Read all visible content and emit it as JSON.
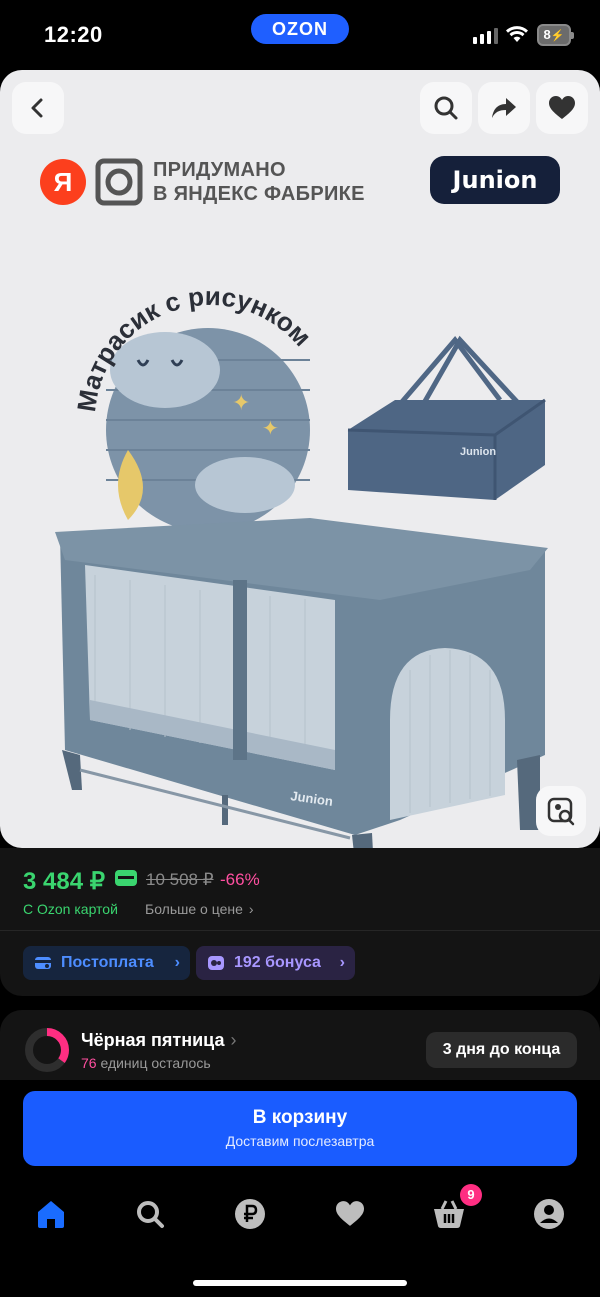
{
  "status_bar": {
    "time": "12:20",
    "app_pill": "OZON",
    "battery": "8"
  },
  "image_card": {
    "top_buttons": {
      "back": "back-icon",
      "search": "search-icon",
      "share": "share-icon",
      "favorite": "heart-icon"
    },
    "brand_line1": "ПРИДУМАНО",
    "brand_line2": "В ЯНДЕКС ФАБРИКЕ",
    "yandex_letter": "Я",
    "junion_logo": "Junion",
    "mattress_caption": "Матрасик с рисунком",
    "bag_label": "Junion",
    "crib_label": "Junion"
  },
  "price": {
    "current": "3 484 ₽",
    "old": "10 508 ₽",
    "discount": "-66%",
    "ozon_card_label": "С Ozon картой",
    "more_price": "Больше о цене",
    "chips": [
      {
        "label": "Постоплата"
      },
      {
        "label": "192 бонуса"
      }
    ]
  },
  "promo": {
    "title": "Чёрная пятница",
    "units_count": "76",
    "units_text": " единиц осталось",
    "countdown": "3 дня до конца",
    "progress": 0.35
  },
  "cart_button": {
    "label": "В корзину",
    "sublabel": "Доставим послезавтра"
  },
  "tabbar": {
    "items": [
      "home-icon",
      "search-icon",
      "ruble-icon",
      "heart-icon",
      "cart-icon",
      "profile-icon"
    ],
    "cart_badge": "9"
  },
  "colors": {
    "accent": "#1a5cff",
    "price_green": "#3ad56f",
    "discount_pink": "#ff4fa0",
    "crib_blue": "#6f879b"
  }
}
